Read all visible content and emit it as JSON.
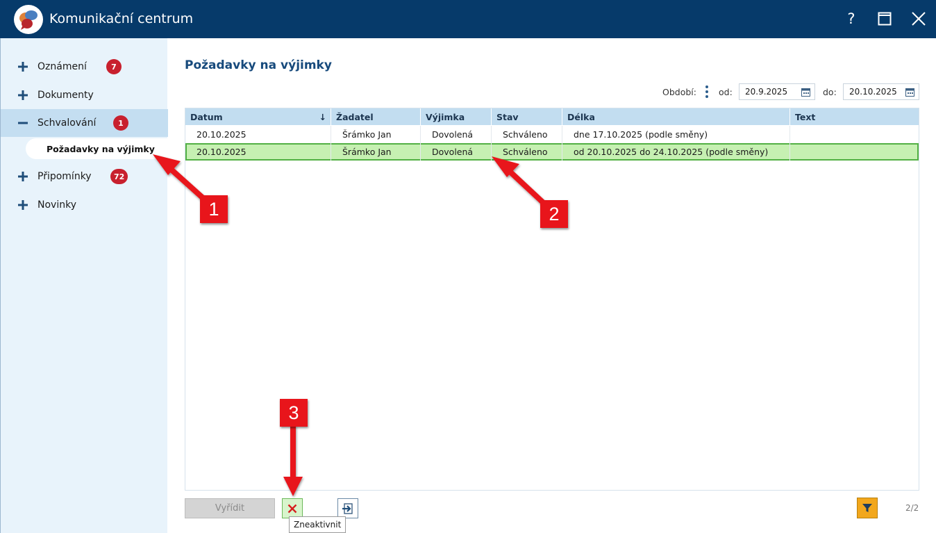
{
  "window": {
    "title": "Komunikační centrum",
    "help_label": "?"
  },
  "sidebar": {
    "items": [
      {
        "label": "Oznámení",
        "badge": "7",
        "expanded": false
      },
      {
        "label": "Dokumenty",
        "badge": "",
        "expanded": false
      },
      {
        "label": "Schvalování",
        "badge": "1",
        "expanded": true
      },
      {
        "label": "Připomínky",
        "badge": "72",
        "expanded": false
      },
      {
        "label": "Novinky",
        "badge": "",
        "expanded": false
      }
    ],
    "subitem": {
      "label": "Požadavky na výjimky"
    }
  },
  "main": {
    "title": "Požadavky na výjimky",
    "period": {
      "label": "Období:",
      "from_label": "od:",
      "from_value": "20.9.2025",
      "to_label": "do:",
      "to_value": "20.10.2025"
    },
    "table": {
      "columns": [
        "Datum",
        "Žadatel",
        "Výjimka",
        "Stav",
        "Délka",
        "Text"
      ],
      "sort_indicator": "↓",
      "rows": [
        [
          "20.10.2025",
          "Šrámko Jan",
          "Dovolená",
          "Schváleno",
          "dne 17.10.2025 (podle směny)",
          ""
        ],
        [
          "20.10.2025",
          "Šrámko Jan",
          "Dovolená",
          "Schváleno",
          "od 20.10.2025 do 24.10.2025 (podle směny)",
          ""
        ]
      ],
      "selected_row": 1
    },
    "buttons": {
      "resolve_label": "Vyřídit",
      "deactivate_tooltip": "Zneaktivnit"
    },
    "paging": "2/2"
  },
  "annotations": {
    "callout_1": "1",
    "callout_2": "2",
    "callout_3": "3"
  },
  "colors": {
    "titlebar": "#063a6a",
    "sidebar_bg": "#e8f3fb",
    "active_nav": "#c4def1",
    "badge": "#c8202e",
    "selected_row": "#c6f0b2",
    "filter_button": "#f2a71c",
    "callout": "#e8151b"
  }
}
